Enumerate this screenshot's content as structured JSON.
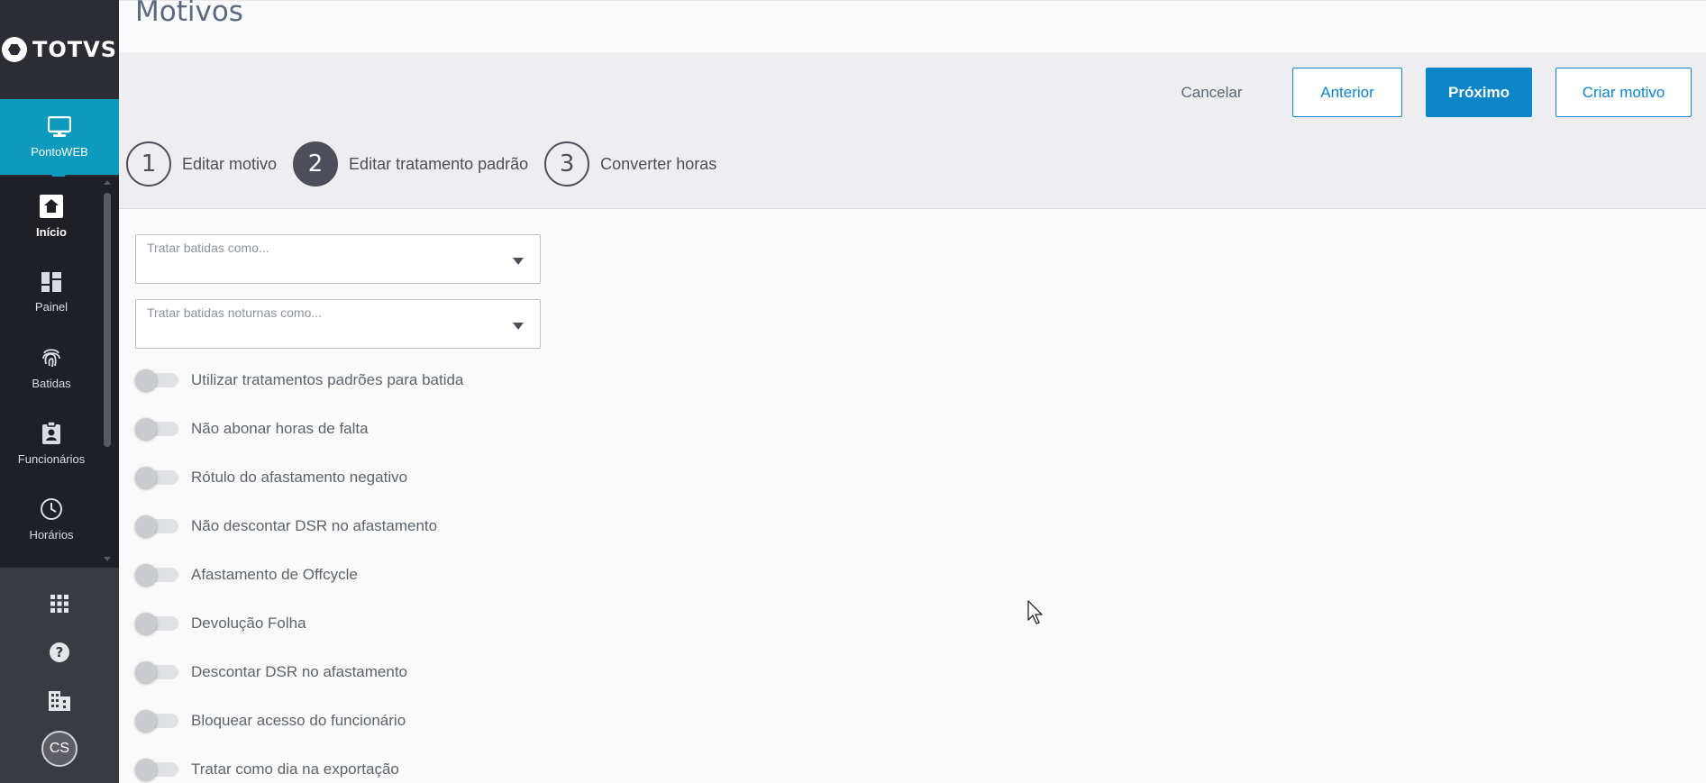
{
  "brand": {
    "name": "TOTVS"
  },
  "product": {
    "label": "PontoWEB",
    "icon": "monitor-icon"
  },
  "sidebar": {
    "items": [
      {
        "label": "Início",
        "icon": "home-icon",
        "active": true
      },
      {
        "label": "Painel",
        "icon": "dashboard-icon",
        "active": false
      },
      {
        "label": "Batidas",
        "icon": "fingerprint-icon",
        "active": false
      },
      {
        "label": "Funcionários",
        "icon": "badge-icon",
        "active": false
      },
      {
        "label": "Horários",
        "icon": "clock-icon",
        "active": false
      }
    ],
    "tools": [
      {
        "icon": "apps-grid-icon"
      },
      {
        "icon": "help-icon"
      },
      {
        "icon": "building-icon"
      }
    ],
    "user_initials": "CS"
  },
  "page": {
    "title": "Motivos"
  },
  "toolbar": {
    "cancel_label": "Cancelar",
    "previous_label": "Anterior",
    "next_label": "Próximo",
    "create_label": "Criar motivo"
  },
  "stepper": {
    "steps": [
      {
        "number": "1",
        "label": "Editar motivo",
        "active": false
      },
      {
        "number": "2",
        "label": "Editar tratamento padrão",
        "active": true
      },
      {
        "number": "3",
        "label": "Converter horas",
        "active": false
      }
    ]
  },
  "form": {
    "select_punches_placeholder": "Tratar batidas como...",
    "select_night_punches_placeholder": "Tratar batidas noturnas como...",
    "toggles": [
      {
        "label": "Utilizar tratamentos padrões para batida",
        "on": false
      },
      {
        "label": "Não abonar horas de falta",
        "on": false
      },
      {
        "label": "Rótulo do afastamento negativo",
        "on": false
      },
      {
        "label": "Não descontar DSR no afastamento",
        "on": false
      },
      {
        "label": "Afastamento de Offcycle",
        "on": false
      },
      {
        "label": "Devolução Folha",
        "on": false
      },
      {
        "label": "Descontar DSR no afastamento",
        "on": false
      },
      {
        "label": "Bloquear acesso do funcionário",
        "on": false
      },
      {
        "label": "Tratar como dia na exportação",
        "on": false
      }
    ]
  },
  "colors": {
    "sidebar_bg": "#2c2c34",
    "accent": "#0c86c8",
    "product_bg": "#0c9abe",
    "step_active": "#4c4f5a"
  }
}
